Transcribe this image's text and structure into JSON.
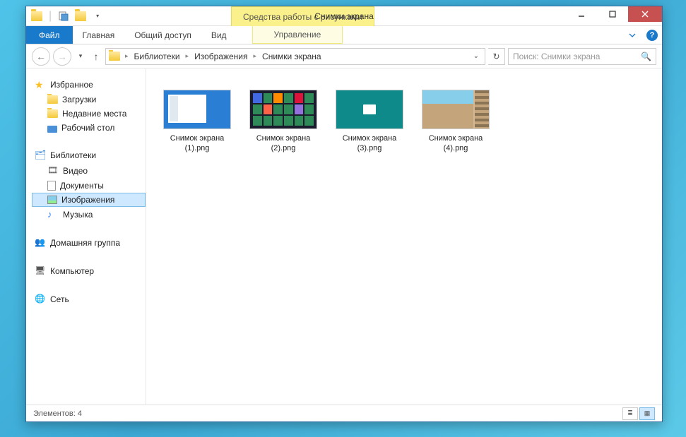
{
  "titlebar": {
    "context_tools": "Средства работы с рисунками",
    "title": "Снимки экрана"
  },
  "ribbon": {
    "file": "Файл",
    "tabs": [
      "Главная",
      "Общий доступ",
      "Вид"
    ],
    "context_tab": "Управление"
  },
  "breadcrumb": {
    "items": [
      "Библиотеки",
      "Изображения",
      "Снимки экрана"
    ]
  },
  "search": {
    "placeholder": "Поиск: Снимки экрана"
  },
  "sidebar": {
    "favorites": {
      "label": "Избранное",
      "items": [
        "Загрузки",
        "Недавние места",
        "Рабочий стол"
      ]
    },
    "libraries": {
      "label": "Библиотеки",
      "items": [
        "Видео",
        "Документы",
        "Изображения",
        "Музыка"
      ]
    },
    "homegroup": {
      "label": "Домашняя группа"
    },
    "computer": {
      "label": "Компьютер"
    },
    "network": {
      "label": "Сеть"
    }
  },
  "files": [
    {
      "name": "Снимок экрана (1).png"
    },
    {
      "name": "Снимок экрана (2).png"
    },
    {
      "name": "Снимок экрана (3).png"
    },
    {
      "name": "Снимок экрана (4).png"
    }
  ],
  "status": {
    "count_label": "Элементов: 4"
  }
}
